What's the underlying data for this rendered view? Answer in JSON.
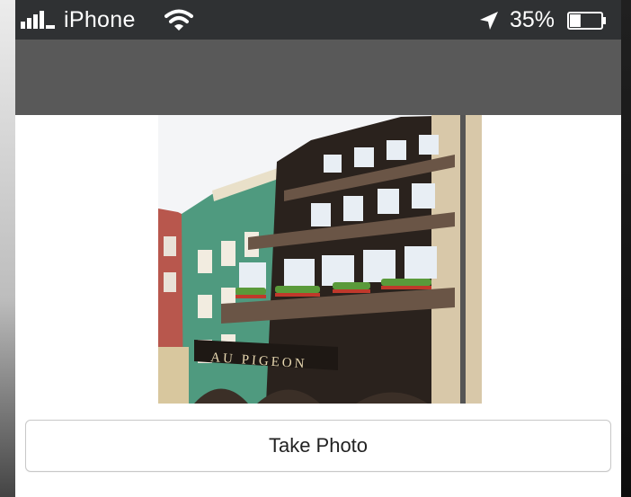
{
  "status_bar": {
    "carrier": "iPhone",
    "battery_percent": "35%",
    "battery_level": 0.35,
    "icons": [
      "signal-bars-icon",
      "wifi-icon",
      "location-arrow-icon",
      "battery-icon"
    ]
  },
  "main": {
    "photo": {
      "caption": "AU PIGEON"
    },
    "take_photo_label": "Take Photo"
  },
  "colors": {
    "status_bar_bg": "#2f3133",
    "nav_bar_bg": "#595959",
    "screen_bg": "#ffffff",
    "button_border": "#c8c8c8"
  }
}
